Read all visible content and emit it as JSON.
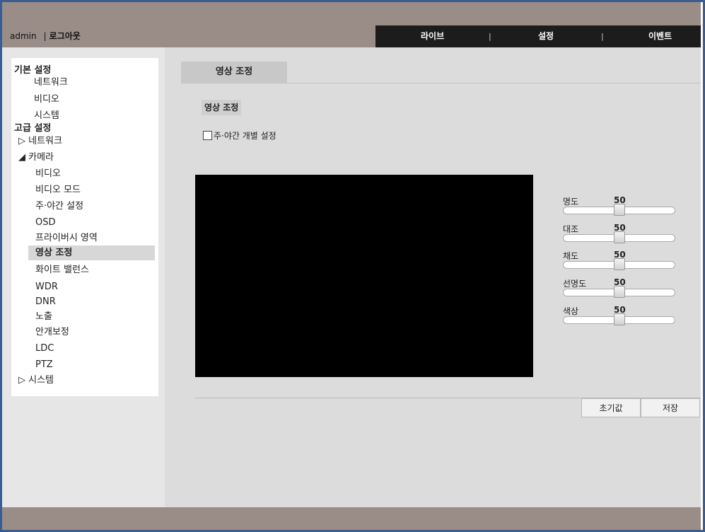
{
  "header": {
    "user": "admin",
    "separator": "|",
    "logout": "로그아웃"
  },
  "nav": {
    "live": "라이브",
    "sep1": "|",
    "settings": "설정",
    "sep2": "|",
    "event": "이벤트"
  },
  "sidebar": {
    "basic_header": "기본 설정",
    "basic_network": "네트워크",
    "basic_video": "비디오",
    "basic_system": "시스템",
    "advanced_header": "고급 설정",
    "adv_network": "▷ 네트워크",
    "adv_camera": "◢ 카메라",
    "camera_items": [
      "비디오",
      "비디오 모드",
      "주·야간 설정",
      "OSD",
      "프라이버시 영역",
      "영상 조정",
      "화이트 밸런스",
      "WDR",
      "DNR",
      "노출",
      "안개보정",
      "LDC",
      "PTZ"
    ],
    "adv_system": "▷ 시스템",
    "active_index": 5
  },
  "main": {
    "tab": "영상 조정",
    "section_title": "영상 조정",
    "checkbox_label": "주·야간 개별 설정",
    "checkbox_checked": false,
    "sliders": [
      {
        "label": "명도",
        "value": "50",
        "level": 0.5
      },
      {
        "label": "대조",
        "value": "50",
        "level": 0.5
      },
      {
        "label": "채도",
        "value": "50",
        "level": 0.5
      },
      {
        "label": "선명도",
        "value": "50",
        "level": 0.5
      },
      {
        "label": "색상",
        "value": "50",
        "level": 0.5
      }
    ],
    "reset_button": "초기값",
    "save_button": "저장"
  },
  "colors": {
    "topbar": "#9a8d88",
    "navbar": "#1c1c1c",
    "border": "#3c5d8c",
    "preview": "#000000"
  }
}
